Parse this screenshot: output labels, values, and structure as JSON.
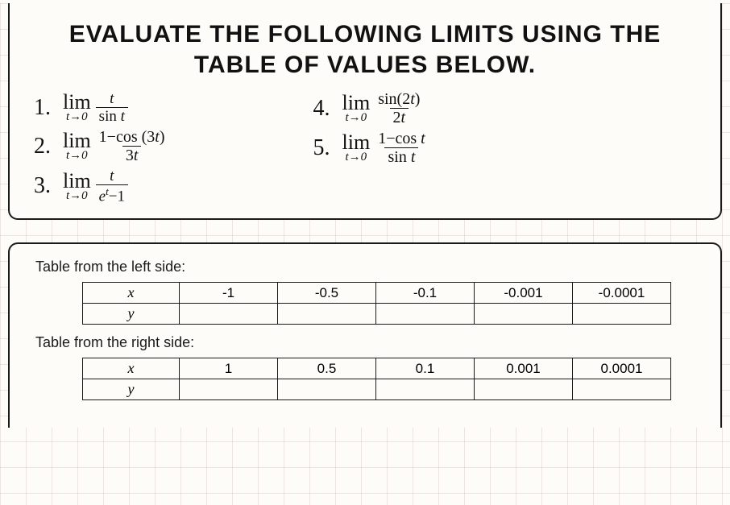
{
  "title_line1": "EVALUATE THE FOLLOWING LIMITS USING THE",
  "title_line2": "TABLE OF VALUES BELOW.",
  "problems_left": [
    {
      "n": "1.",
      "lim_top": "lim",
      "lim_bot": "t→0",
      "frac_num": "t",
      "frac_den_pre": "sin ",
      "frac_den_var": "t"
    },
    {
      "n": "2.",
      "lim_top": "lim",
      "lim_bot": "t→0",
      "frac_num_pre": "1−cos (3",
      "frac_num_var": "t",
      "frac_num_post": ")",
      "frac_den_pre": "3",
      "frac_den_var": "t"
    },
    {
      "n": "3.",
      "lim_top": "lim",
      "lim_bot": "t→0",
      "frac_num": "t",
      "frac_den_html": true
    }
  ],
  "problems_right": [
    {
      "n": "4.",
      "lim_top": "lim",
      "lim_bot": "t→0",
      "frac_num_pre": "sin(2",
      "frac_num_var": "t",
      "frac_num_post": ")",
      "frac_den_pre": "2",
      "frac_den_var": "t"
    },
    {
      "n": "5.",
      "lim_top": "lim",
      "lim_bot": "t→0",
      "frac_num_pre": "1−cos ",
      "frac_num_var": "t",
      "frac_den_pre": "sin ",
      "frac_den_var": "t"
    }
  ],
  "p3_den": {
    "e": "e",
    "exp": "t",
    "minus1": "−1"
  },
  "labels": {
    "left": "Table from the left side:",
    "right": "Table from the right side:"
  },
  "left_table": {
    "row_hdr1": "x",
    "row_hdr2": "y",
    "x": [
      "-1",
      "-0.5",
      "-0.1",
      "-0.001",
      "-0.0001"
    ],
    "y": [
      "",
      "",
      "",
      "",
      ""
    ]
  },
  "right_table": {
    "row_hdr1": "x",
    "row_hdr2": "y",
    "x": [
      "1",
      "0.5",
      "0.1",
      "0.001",
      "0.0001"
    ],
    "y": [
      "",
      "",
      "",
      "",
      ""
    ]
  },
  "chart_data": [
    {
      "type": "table",
      "title": "Table from the left side",
      "categories": [
        "-1",
        "-0.5",
        "-0.1",
        "-0.001",
        "-0.0001"
      ],
      "series": [
        {
          "name": "x",
          "values": [
            -1,
            -0.5,
            -0.1,
            -0.001,
            -0.0001
          ]
        },
        {
          "name": "y",
          "values": [
            null,
            null,
            null,
            null,
            null
          ]
        }
      ]
    },
    {
      "type": "table",
      "title": "Table from the right side",
      "categories": [
        "1",
        "0.5",
        "0.1",
        "0.001",
        "0.0001"
      ],
      "series": [
        {
          "name": "x",
          "values": [
            1,
            0.5,
            0.1,
            0.001,
            0.0001
          ]
        },
        {
          "name": "y",
          "values": [
            null,
            null,
            null,
            null,
            null
          ]
        }
      ]
    }
  ]
}
